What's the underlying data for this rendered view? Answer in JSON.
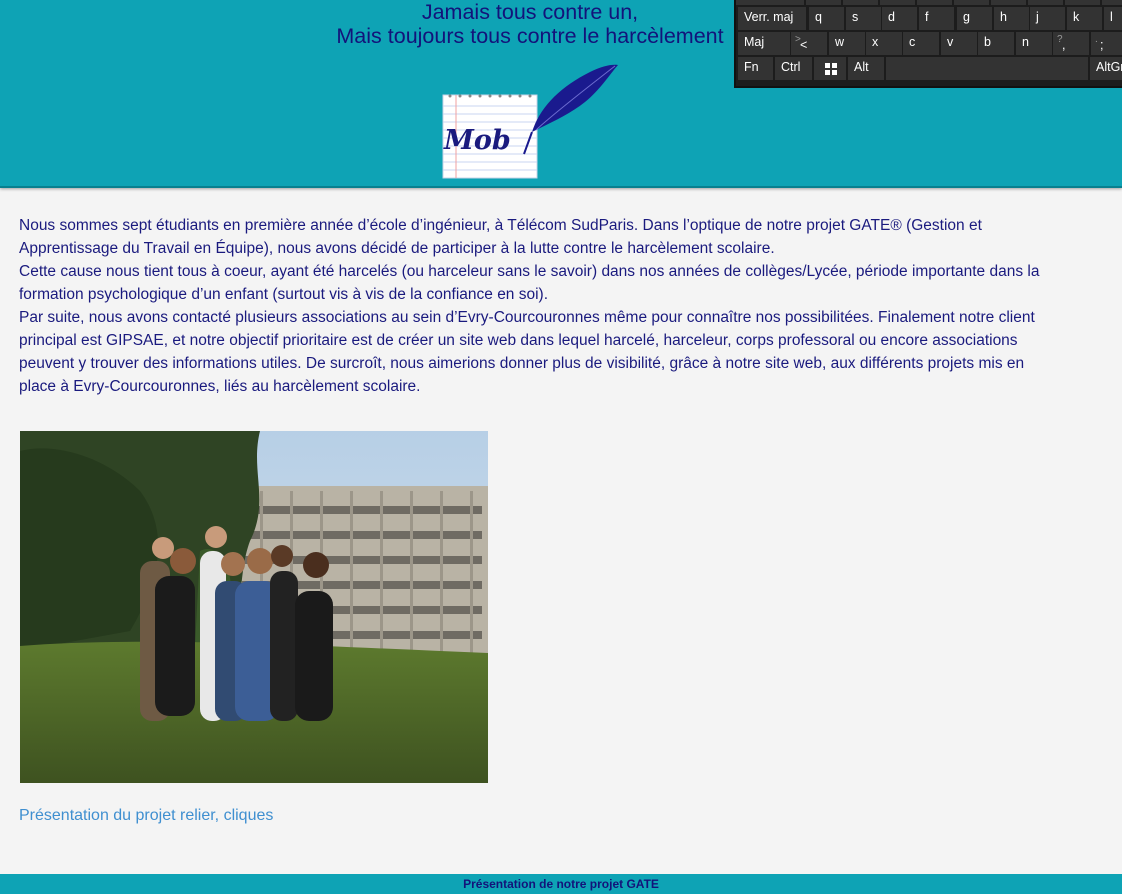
{
  "header": {
    "slogan_line1": "Jamais tous contre un,",
    "slogan_line2": "Mais toujours tous contre le harcèlement",
    "logo_text": "Mob"
  },
  "keyboard": {
    "row2": [
      {
        "label": "Verr. maj",
        "sub": ""
      },
      {
        "label": "q",
        "sub": ""
      },
      {
        "label": "s",
        "sub": ""
      },
      {
        "label": "d",
        "sub": ""
      },
      {
        "label": "f",
        "sub": ""
      },
      {
        "label": "g",
        "sub": ""
      },
      {
        "label": "h",
        "sub": ""
      },
      {
        "label": "j",
        "sub": ""
      },
      {
        "label": "k",
        "sub": ""
      },
      {
        "label": "l",
        "sub": ""
      }
    ],
    "row3": [
      {
        "label": "Maj",
        "sub": ""
      },
      {
        "label": "<",
        "sub": ">"
      },
      {
        "label": "w",
        "sub": ""
      },
      {
        "label": "x",
        "sub": ""
      },
      {
        "label": "c",
        "sub": ""
      },
      {
        "label": "v",
        "sub": ""
      },
      {
        "label": "b",
        "sub": ""
      },
      {
        "label": "n",
        "sub": ""
      },
      {
        "label": ",",
        "sub": "?"
      },
      {
        "label": ";",
        "sub": "."
      }
    ],
    "row4": [
      {
        "label": "Fn"
      },
      {
        "label": "Ctrl"
      },
      {
        "label": "",
        "icon": "windows-icon"
      },
      {
        "label": "Alt"
      },
      {
        "label": ""
      },
      {
        "label": "AltGr"
      }
    ]
  },
  "main": {
    "paragraphs": [
      "Nous sommes sept étudiants en première année d’école d’ingénieur, à Télécom SudParis. Dans l’optique de notre projet GATE® (Gestion et Apprentissage du Travail en Équipe), nous avons décidé de participer à la lutte contre le harcèlement scolaire.",
      "Cette cause nous tient tous à coeur, ayant été harcelés (ou harceleur sans le savoir) dans nos années de collèges/Lycée, période importante dans la formation psychologique d’un enfant (surtout vis à vis de la confiance en soi).",
      "Par suite, nous avons contacté plusieurs associations au sein d’Evry-Courcouronnes même pour connaître nos possibilitées. Finalement notre client principal est GIPSAE, et notre objectif prioritaire est de créer un site web dans lequel harcelé, harceleur, corps professoral ou encore associations peuvent y trouver des informations utiles. De surcroît, nous aimerions donner plus de visibilité, grâce à notre site web, aux différents projets mis en place à Evry-Courcouronnes, liés au harcèlement scolaire."
    ],
    "link_text": "Présentation du projet relier, cliques"
  },
  "footer": {
    "text": "Présentation de notre projet GATE"
  }
}
